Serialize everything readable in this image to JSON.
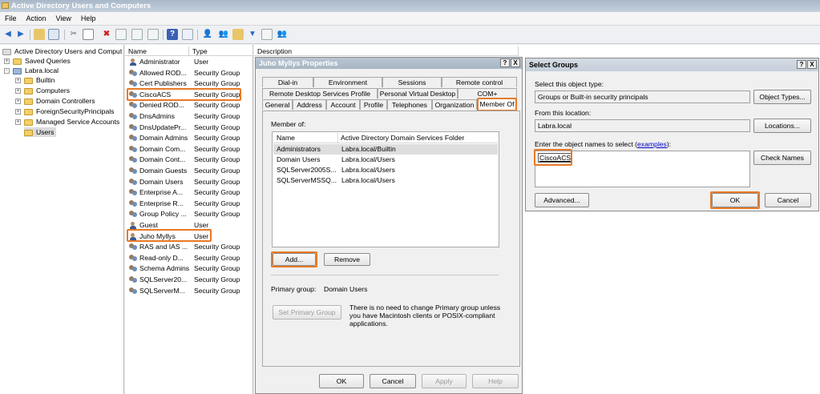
{
  "window": {
    "title": "Active Directory Users and Computers"
  },
  "menu": [
    "File",
    "Action",
    "View",
    "Help"
  ],
  "tree": {
    "items": [
      {
        "label": "Active Directory Users and Comput",
        "level": 0,
        "expander": ""
      },
      {
        "label": "Saved Queries",
        "level": 1,
        "expander": "+"
      },
      {
        "label": "Labra.local",
        "level": 1,
        "expander": "-"
      },
      {
        "label": "Builtin",
        "level": 2,
        "expander": "+"
      },
      {
        "label": "Computers",
        "level": 2,
        "expander": "+"
      },
      {
        "label": "Domain Controllers",
        "level": 2,
        "expander": "+"
      },
      {
        "label": "ForeignSecurityPrincipals",
        "level": 2,
        "expander": "+"
      },
      {
        "label": "Managed Service Accounts",
        "level": 2,
        "expander": "+"
      },
      {
        "label": "Users",
        "level": 2,
        "expander": ""
      }
    ]
  },
  "list": {
    "headers": {
      "name": "Name",
      "type": "Type",
      "description": "Description"
    },
    "rows": [
      {
        "name": "Administrator",
        "type": "User",
        "icon": "user-icon"
      },
      {
        "name": "Allowed ROD...",
        "type": "Security Group ...",
        "icon": "group-icon"
      },
      {
        "name": "Cert Publishers",
        "type": "Security Group ...",
        "icon": "group-icon"
      },
      {
        "name": "CiscoACS",
        "type": "Security Group",
        "icon": "group-icon"
      },
      {
        "name": "Denied ROD...",
        "type": "Security Group ...",
        "icon": "group-icon"
      },
      {
        "name": "DnsAdmins",
        "type": "Security Group ...",
        "icon": "group-icon"
      },
      {
        "name": "DnsUpdatePr...",
        "type": "Security Group ...",
        "icon": "group-icon"
      },
      {
        "name": "Domain Admins",
        "type": "Security Group ...",
        "icon": "group-icon"
      },
      {
        "name": "Domain Com...",
        "type": "Security Group ...",
        "icon": "group-icon"
      },
      {
        "name": "Domain Cont...",
        "type": "Security Group ...",
        "icon": "group-icon"
      },
      {
        "name": "Domain Guests",
        "type": "Security Group ...",
        "icon": "group-icon"
      },
      {
        "name": "Domain Users",
        "type": "Security Group ...",
        "icon": "group-icon"
      },
      {
        "name": "Enterprise A...",
        "type": "Security Group ...",
        "icon": "group-icon"
      },
      {
        "name": "Enterprise R...",
        "type": "Security Group ...",
        "icon": "group-icon"
      },
      {
        "name": "Group Policy ...",
        "type": "Security Group ...",
        "icon": "group-icon"
      },
      {
        "name": "Guest",
        "type": "User",
        "icon": "user-icon"
      },
      {
        "name": "Juho Myllys",
        "type": "User",
        "icon": "user-icon"
      },
      {
        "name": "RAS and IAS ...",
        "type": "Security Group ...",
        "icon": "group-icon"
      },
      {
        "name": "Read-only D...",
        "type": "Security Group ...",
        "icon": "group-icon"
      },
      {
        "name": "Schema Admins",
        "type": "Security Group ...",
        "icon": "group-icon"
      },
      {
        "name": "SQLServer20...",
        "type": "Security Group ...",
        "icon": "group-icon"
      },
      {
        "name": "SQLServerM...",
        "type": "Security Group ...",
        "icon": "group-icon"
      }
    ]
  },
  "properties": {
    "title": "Juho Myllys Properties",
    "help": "?",
    "close": "X",
    "tabs_row1": [
      "Dial-in",
      "Environment",
      "Sessions",
      "Remote control"
    ],
    "tabs_row2": [
      "Remote Desktop Services Profile",
      "Personal Virtual Desktop",
      "COM+"
    ],
    "tabs_row3": [
      "General",
      "Address",
      "Account",
      "Profile",
      "Telephones",
      "Organization",
      "Member Of"
    ],
    "member_of_label": "Member of:",
    "col_name": "Name",
    "col_folder": "Active Directory Domain Services Folder",
    "members": [
      {
        "name": "Administrators",
        "folder": "Labra.local/Builtin"
      },
      {
        "name": "Domain Users",
        "folder": "Labra.local/Users"
      },
      {
        "name": "SQLServer2005S...",
        "folder": "Labra.local/Users"
      },
      {
        "name": "SQLServerMSSQ...",
        "folder": "Labra.local/Users"
      }
    ],
    "add": "Add...",
    "remove": "Remove",
    "primary_group_label": "Primary group:",
    "primary_group_value": "Domain Users",
    "set_primary": "Set Primary Group",
    "note": "There is no need to change Primary group unless you have Macintosh clients or POSIX-compliant applications.",
    "ok": "OK",
    "cancel": "Cancel",
    "apply": "Apply",
    "help_btn": "Help"
  },
  "select_groups": {
    "title": "Select Groups",
    "help": "?",
    "close": "X",
    "object_type_label": "Select this object type:",
    "object_type_value": "Groups or Built-in security principals",
    "object_types_btn": "Object Types...",
    "location_label": "From this location:",
    "location_value": "Labra.local",
    "locations_btn": "Locations...",
    "enter_label_prefix": "Enter the object names to select (",
    "enter_label_link": "examples",
    "enter_label_suffix": "):",
    "entered_value": "CiscoACS",
    "check_names_btn": "Check Names",
    "advanced_btn": "Advanced...",
    "ok": "OK",
    "cancel": "Cancel"
  },
  "colors": {
    "highlight": "#e87a26",
    "title_inactive": "#a8b6c4",
    "link": "#0000cc"
  }
}
